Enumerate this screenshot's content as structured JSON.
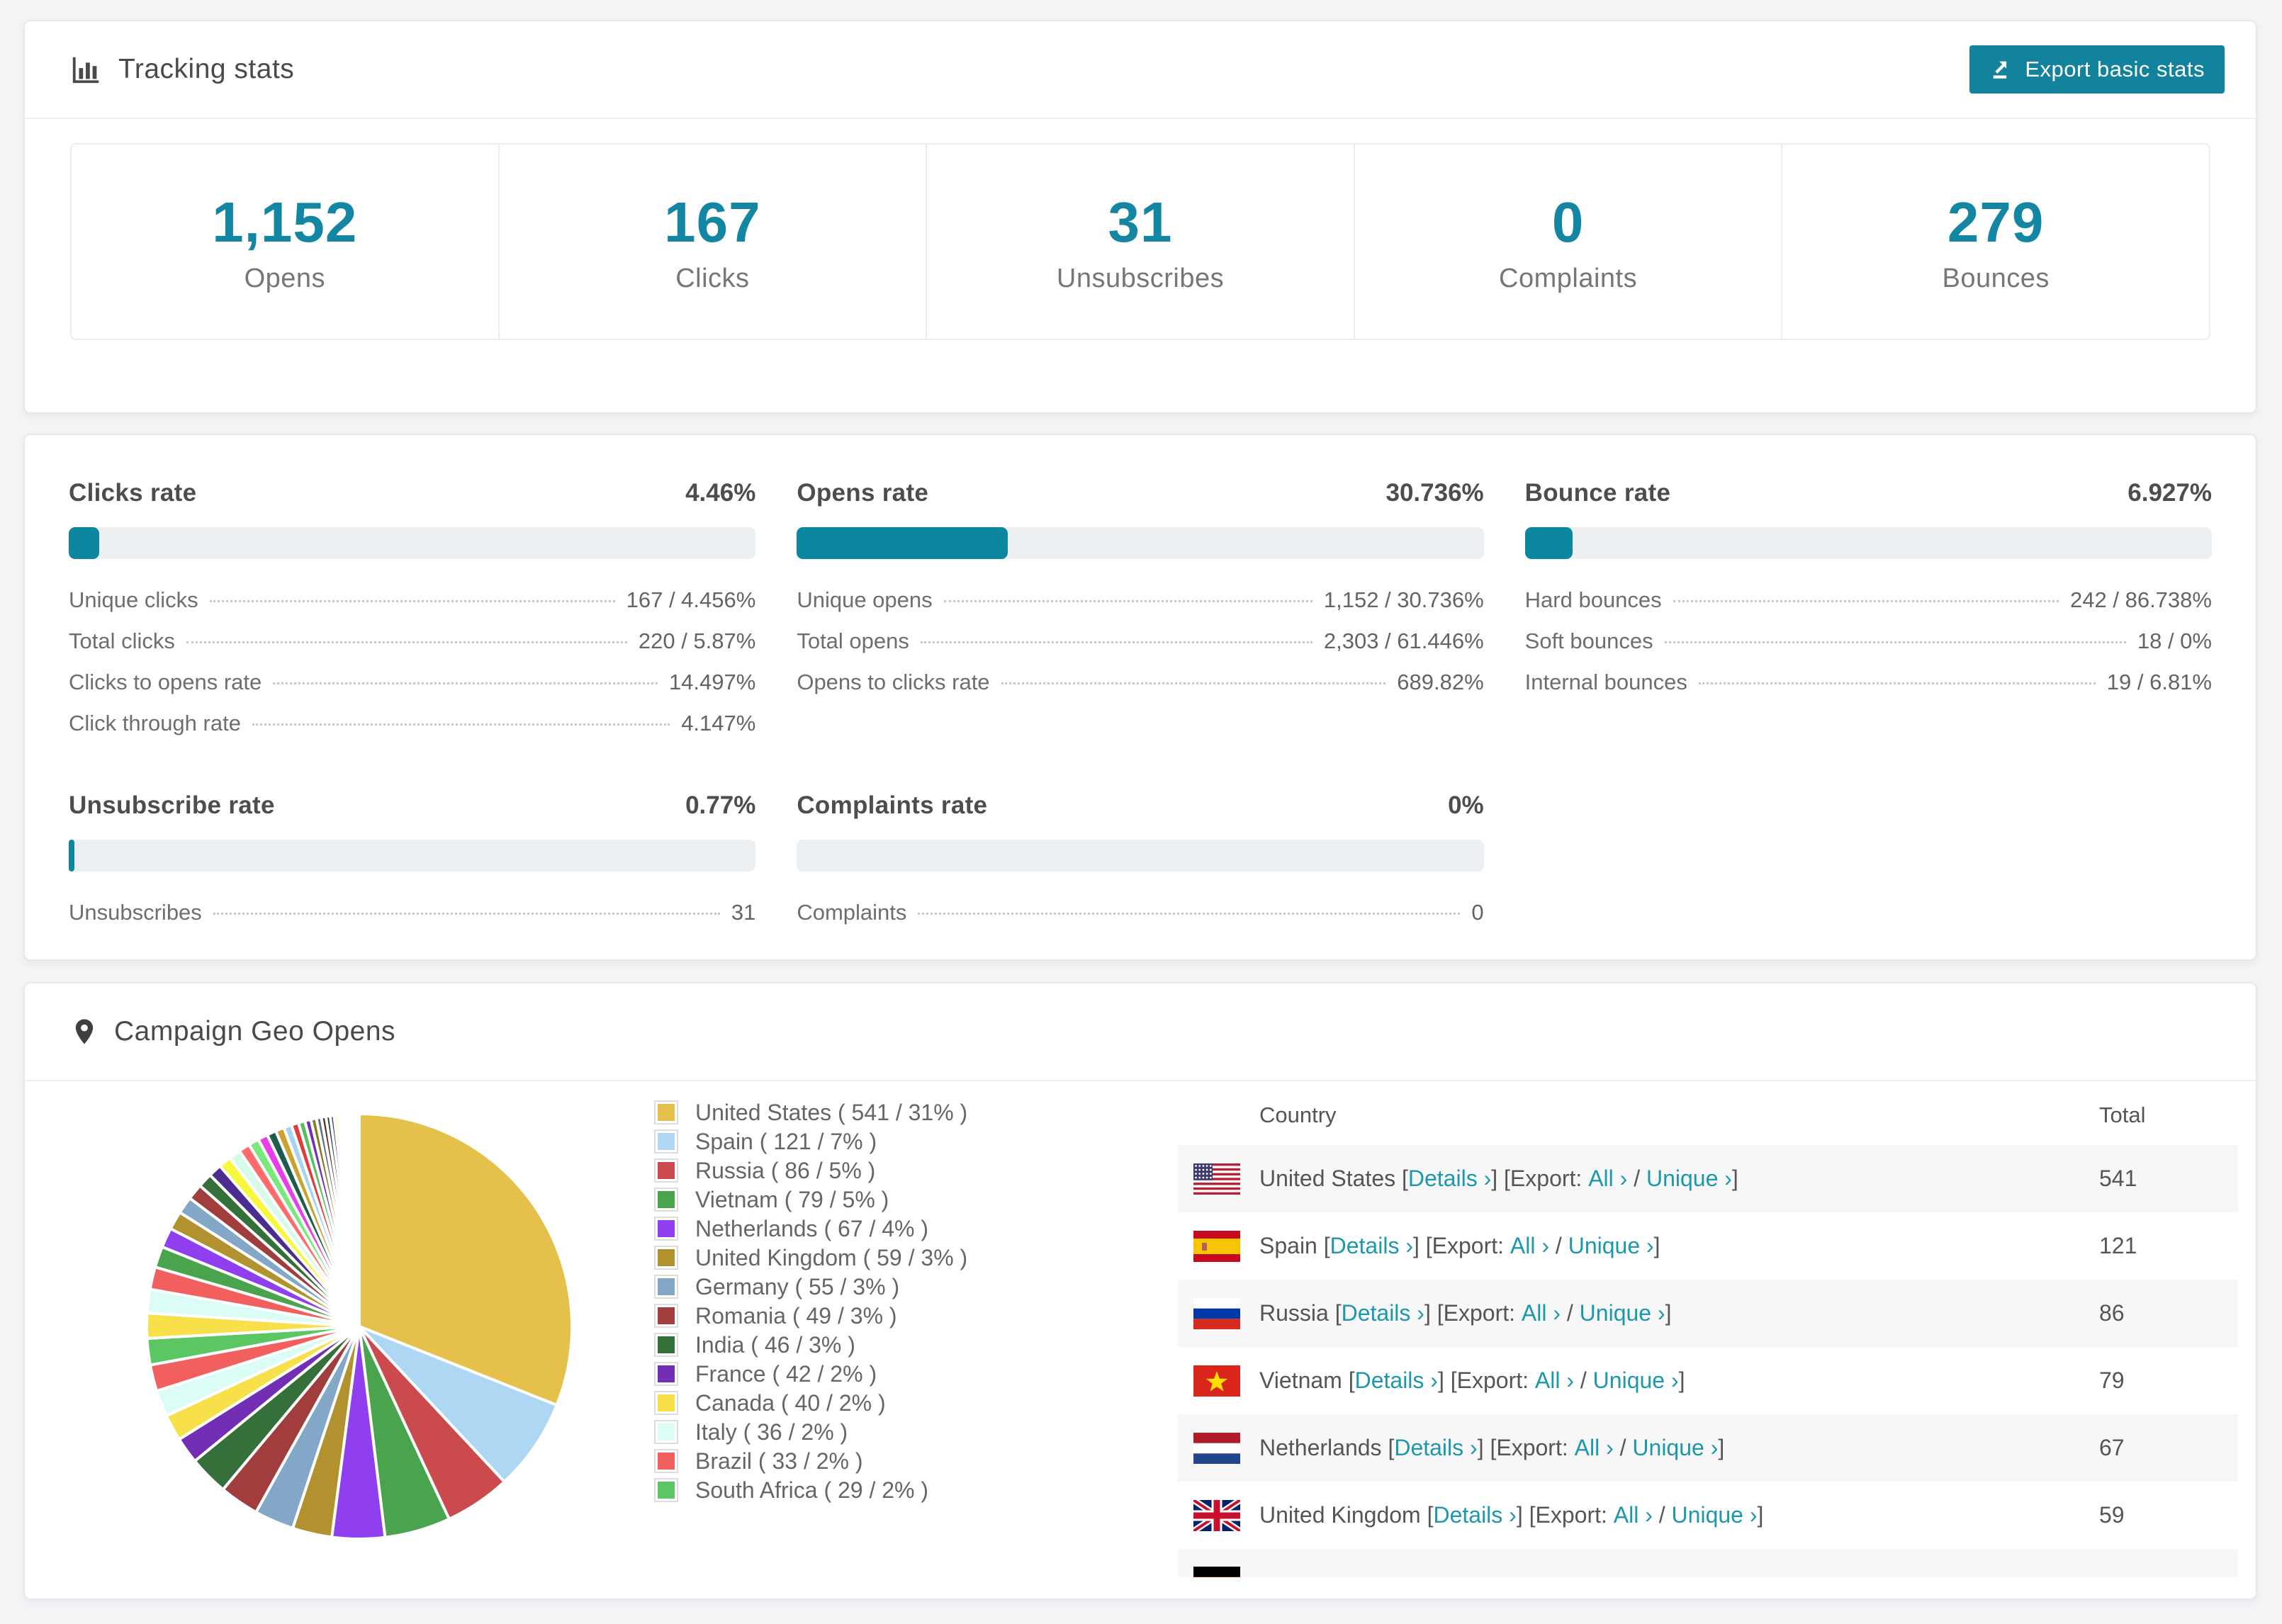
{
  "colors": {
    "accent": "#0d86a0",
    "button": "#13829c",
    "link": "#1d97ad",
    "big_number": "#1286a3",
    "bar_bg": "#edf0f2",
    "card_bg": "#ffffff",
    "page_bg": "#f4f4f6",
    "row_alt_bg": "#f7f7f8"
  },
  "tracking": {
    "title": "Tracking stats",
    "export_button": "Export basic stats",
    "stats": [
      {
        "value": "1,152",
        "label": "Opens"
      },
      {
        "value": "167",
        "label": "Clicks"
      },
      {
        "value": "31",
        "label": "Unsubscribes"
      },
      {
        "value": "0",
        "label": "Complaints"
      },
      {
        "value": "279",
        "label": "Bounces"
      }
    ]
  },
  "rates": {
    "sections": [
      {
        "title": "Clicks rate",
        "value": "4.46%",
        "percent": 4.46,
        "rows": [
          {
            "label": "Unique clicks",
            "value": "167 / 4.456%"
          },
          {
            "label": "Total clicks",
            "value": "220 / 5.87%"
          },
          {
            "label": "Clicks to opens rate",
            "value": "14.497%"
          },
          {
            "label": "Click through rate",
            "value": "4.147%"
          }
        ]
      },
      {
        "title": "Opens rate",
        "value": "30.736%",
        "percent": 30.736,
        "rows": [
          {
            "label": "Unique opens",
            "value": "1,152 / 30.736%"
          },
          {
            "label": "Total opens",
            "value": "2,303 / 61.446%"
          },
          {
            "label": "Opens to clicks rate",
            "value": "689.82%"
          }
        ]
      },
      {
        "title": "Bounce rate",
        "value": "6.927%",
        "percent": 6.927,
        "rows": [
          {
            "label": "Hard bounces",
            "value": "242 / 86.738%"
          },
          {
            "label": "Soft bounces",
            "value": "18 / 0%"
          },
          {
            "label": "Internal bounces",
            "value": "19 / 6.81%"
          }
        ]
      },
      {
        "title": "Unsubscribe rate",
        "value": "0.77%",
        "percent": 0.77,
        "rows": [
          {
            "label": "Unsubscribes",
            "value": "31"
          }
        ]
      },
      {
        "title": "Complaints rate",
        "value": "0%",
        "percent": 0,
        "rows": [
          {
            "label": "Complaints",
            "value": "0"
          }
        ]
      }
    ]
  },
  "geo": {
    "title": "Campaign Geo Opens",
    "legend": [
      {
        "name": "United States",
        "count": "541",
        "pct": "31",
        "color": "#e5c04a"
      },
      {
        "name": "Spain",
        "count": "121",
        "pct": "7",
        "color": "#aed7f4"
      },
      {
        "name": "Russia",
        "count": "86",
        "pct": "5",
        "color": "#ca4a4e"
      },
      {
        "name": "Vietnam",
        "count": "79",
        "pct": "5",
        "color": "#4aa44d"
      },
      {
        "name": "Netherlands",
        "count": "67",
        "pct": "4",
        "color": "#8f3ff0"
      },
      {
        "name": "United Kingdom",
        "count": "59",
        "pct": "3",
        "color": "#b2912f"
      },
      {
        "name": "Germany",
        "count": "55",
        "pct": "3",
        "color": "#83a7c6"
      },
      {
        "name": "Romania",
        "count": "49",
        "pct": "3",
        "color": "#a23d3d"
      },
      {
        "name": "India",
        "count": "46",
        "pct": "3",
        "color": "#35703a"
      },
      {
        "name": "France",
        "count": "42",
        "pct": "2",
        "color": "#722fb5"
      },
      {
        "name": "Canada",
        "count": "40",
        "pct": "2",
        "color": "#f8e04b"
      },
      {
        "name": "Italy",
        "count": "36",
        "pct": "2",
        "color": "#dbfdf6"
      },
      {
        "name": "Brazil",
        "count": "33",
        "pct": "2",
        "color": "#f25f5f"
      },
      {
        "name": "South Africa",
        "count": "29",
        "pct": "2",
        "color": "#5ac763"
      }
    ],
    "table": {
      "headers": [
        "Country",
        "Total"
      ],
      "links": {
        "details": "Details ›",
        "export_prefix": "[Export: ",
        "all": "All ›",
        "slash": " / ",
        "unique": "Unique ›",
        "open": " [",
        "close": "] ",
        "end": "]"
      },
      "rows": [
        {
          "country": "United States",
          "flag": "us",
          "total": "541"
        },
        {
          "country": "Spain",
          "flag": "es",
          "total": "121"
        },
        {
          "country": "Russia",
          "flag": "ru",
          "total": "86"
        },
        {
          "country": "Vietnam",
          "flag": "vn",
          "total": "79"
        },
        {
          "country": "Netherlands",
          "flag": "nl",
          "total": "67"
        },
        {
          "country": "United Kingdom",
          "flag": "gb",
          "total": "59"
        },
        {
          "country": "",
          "flag": "de",
          "total": "",
          "clipped": true
        }
      ]
    }
  },
  "chart_data": {
    "type": "pie",
    "title": "Campaign Geo Opens",
    "legend_position": "right",
    "labels": [
      "United States",
      "Spain",
      "Russia",
      "Vietnam",
      "Netherlands",
      "United Kingdom",
      "Germany",
      "Romania",
      "India",
      "France",
      "Canada",
      "Italy",
      "Brazil",
      "South Africa"
    ],
    "counts": [
      541,
      121,
      86,
      79,
      67,
      59,
      55,
      49,
      46,
      42,
      40,
      36,
      33,
      29
    ],
    "percents": [
      31,
      7,
      5,
      5,
      4,
      3,
      3,
      3,
      3,
      2,
      2,
      2,
      2,
      2
    ],
    "colors": [
      "#e5c04a",
      "#aed7f4",
      "#ca4a4e",
      "#4aa44d",
      "#8f3ff0",
      "#b2912f",
      "#83a7c6",
      "#a23d3d",
      "#35703a",
      "#722fb5",
      "#f8e04b",
      "#dbfdf6",
      "#f25f5f",
      "#5ac763"
    ],
    "other_segments": {
      "description": "many small unlabeled country slices totaling ~26%",
      "values": [
        1.9,
        1.8,
        1.7,
        1.6,
        1.5,
        1.4,
        1.3,
        1.2,
        1.1,
        1.0,
        0.95,
        0.9,
        0.85,
        0.8,
        0.75,
        0.7,
        0.65,
        0.6,
        0.55,
        0.5,
        0.46,
        0.42,
        0.38,
        0.35,
        0.32,
        0.29,
        0.26,
        0.23,
        0.2,
        0.18,
        0.16,
        0.14,
        0.12,
        0.1,
        0.09,
        0.08,
        0.07,
        0.06,
        0.05,
        0.04,
        0.03,
        0.03,
        0.02,
        0.02,
        0.01,
        0.01
      ],
      "colors": [
        "#f8e04b",
        "#dbfdf6",
        "#f25f5f",
        "#4aa44d",
        "#8f3ff0",
        "#b2912f",
        "#83a7c6",
        "#a23d3d",
        "#35703a",
        "#4a2d8f",
        "#f7f73c",
        "#d7fbe8",
        "#ff6b6b",
        "#7ae87a",
        "#e93de9",
        "#1e5c4f",
        "#caa32e",
        "#a8d3f0",
        "#e23b3b",
        "#57c05e",
        "#722fb5",
        "#8a7a1e",
        "#5a7286",
        "#6e2424",
        "#0f3d2e",
        "#2e2a72",
        "#f7f73c",
        "#dffbf3",
        "#ff5c5c",
        "#66dd66",
        "#e93de9",
        "#caa32e",
        "#a8d3f0",
        "#e23b3b",
        "#57c05e",
        "#9a3ff2",
        "#b2912f",
        "#83a7c6",
        "#a23d3d",
        "#35703a",
        "#722fb5",
        "#f8e04b",
        "#dbfdf6",
        "#f25f5f",
        "#4aa44d",
        "#8f3ff0"
      ]
    }
  }
}
